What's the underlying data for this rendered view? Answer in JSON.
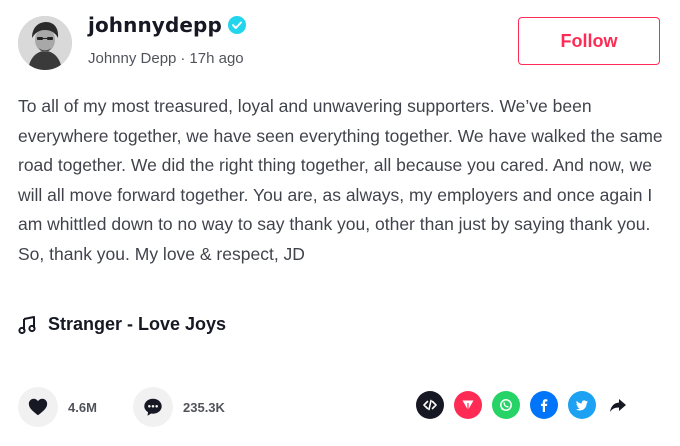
{
  "author": {
    "username": "johnnydepp",
    "display_name": "Johnny Depp",
    "separator": "·",
    "posted_ago": "17h ago",
    "verified": true
  },
  "follow_button": {
    "label": "Follow"
  },
  "caption": "To all of my most treasured, loyal and unwavering supporters. We’ve been everywhere together, we have seen everything together. We have walked the same road together. We did the right thing together, all because you cared. And now, we will all move forward together. You are, as always, my employers and once again I am whittled down to no way to say thank you, other than just by saying thank you. So, thank you. My love & respect, JD",
  "music": {
    "title": "Stranger - Love Joys",
    "icon": "music-note-icon"
  },
  "stats": {
    "likes": "4.6M",
    "comments": "235.3K"
  },
  "share_targets": [
    {
      "name": "embed-icon",
      "color": "#161823"
    },
    {
      "name": "send-to-friends-icon",
      "color": "#fe2c55"
    },
    {
      "name": "whatsapp-icon",
      "color": "#25d366"
    },
    {
      "name": "facebook-icon",
      "color": "#0075fa"
    },
    {
      "name": "twitter-icon",
      "color": "#1da1f2"
    },
    {
      "name": "share-arrow-icon",
      "color": "#161823"
    }
  ],
  "colors": {
    "accent": "#fe2c55",
    "verified": "#20d5ec",
    "text": "#161823"
  }
}
